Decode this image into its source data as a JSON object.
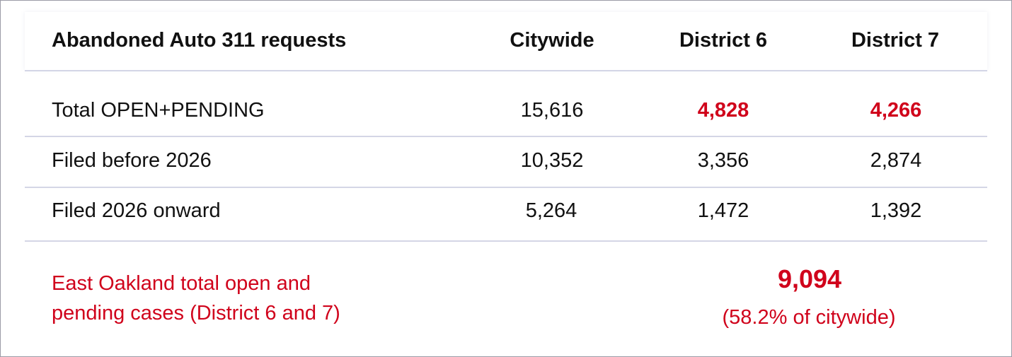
{
  "table": {
    "columns": [
      "Abandoned Auto 311 requests",
      "Citywide",
      "District 6",
      "District 7"
    ],
    "rows": [
      {
        "label": "Total OPEN+PENDING",
        "citywide": "15,616",
        "district6": "4,828",
        "district7": "4,266"
      },
      {
        "label": "Filed before 2026",
        "citywide": "10,352",
        "district6": "3,356",
        "district7": "2,874"
      },
      {
        "label": "Filed 2026 onward",
        "citywide": "5,264",
        "district6": "1,472",
        "district7": "1,392"
      }
    ]
  },
  "summary": {
    "label_line1": "East Oakland total open and",
    "label_line2": "pending cases (District 6 and 7)",
    "total": "9,094",
    "percent": "(58.2% of citywide)"
  },
  "colors": {
    "highlight": "#d0021b",
    "text": "#111111",
    "rule": "#d4d6e6",
    "border": "#9b9ba6"
  }
}
